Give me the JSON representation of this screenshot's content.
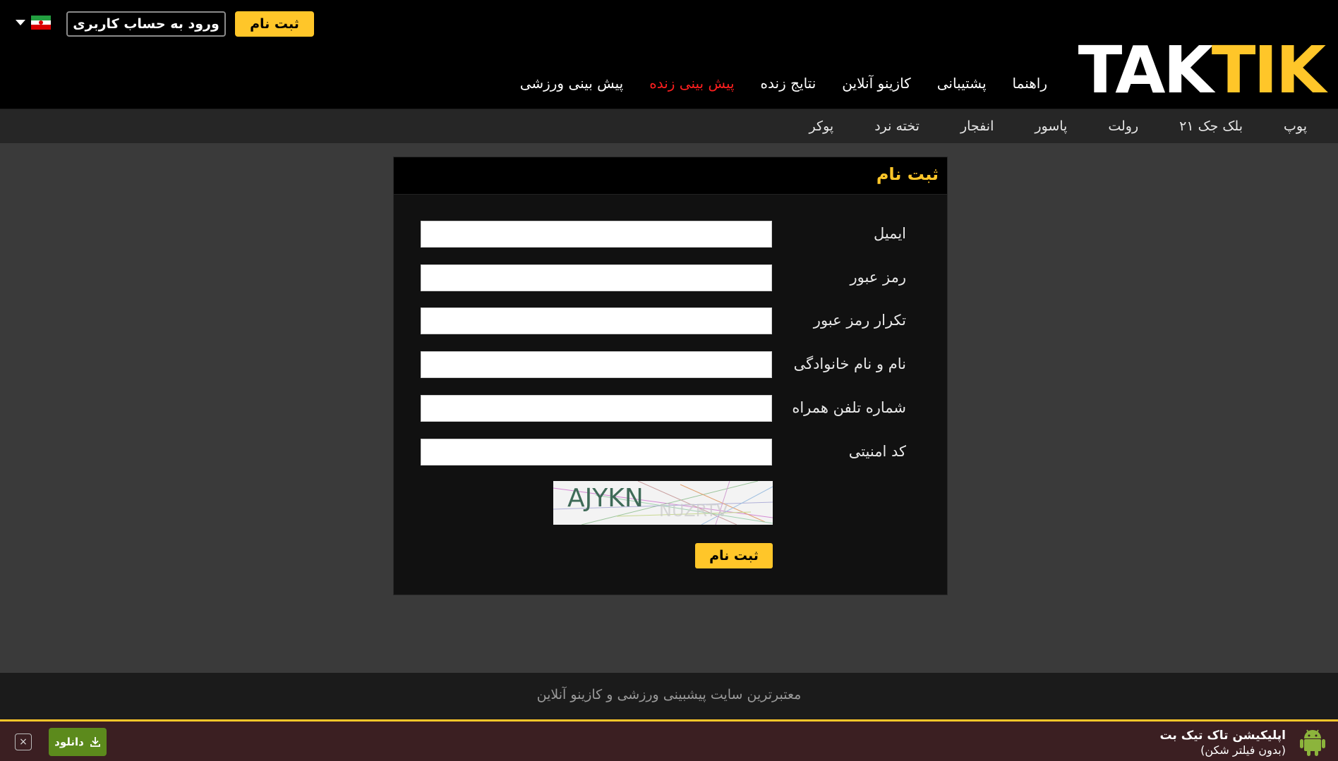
{
  "header": {
    "logo_left": "TAK",
    "logo_right": "TIK",
    "login_label": "ورود به حساب کاربری",
    "register_label": "ثبت نام",
    "nav": [
      {
        "label": "پیش بینی ورزشی"
      },
      {
        "label": "پیش بینی زنده",
        "active": true
      },
      {
        "label": "نتایج زنده"
      },
      {
        "label": "کازینو آنلاین"
      },
      {
        "label": "پشتیبانی"
      },
      {
        "label": "راهنما"
      }
    ]
  },
  "sub_nav": [
    {
      "label": "پوکر"
    },
    {
      "label": "تخته نرد"
    },
    {
      "label": "انفجار"
    },
    {
      "label": "پاسور"
    },
    {
      "label": "رولت"
    },
    {
      "label": "بلک جک ۲۱"
    },
    {
      "label": "پوپ"
    }
  ],
  "form": {
    "title": "ثبت نام",
    "fields": [
      {
        "label": "ایمیل",
        "value": "",
        "placeholder": ""
      },
      {
        "label": "رمز عبور",
        "value": "",
        "placeholder": ""
      },
      {
        "label": "تکرار رمز عبور",
        "value": "",
        "placeholder": ""
      },
      {
        "label": "نام و نام خانوادگی",
        "value": "",
        "placeholder": ""
      },
      {
        "label": "شماره تلفن همراه",
        "value": "",
        "placeholder": ""
      },
      {
        "label": "کد امنیتی",
        "value": "",
        "placeholder": ""
      }
    ],
    "captcha_text": "AJYKN",
    "submit_label": "ثبت نام"
  },
  "footer": {
    "text": "معتبرترین سایت پیشبینی ورزشی و کازینو آنلاین"
  },
  "app_banner": {
    "title": "اپلیکیشن تاک تیک بت",
    "subtitle": "(بدون فیلتر شکن)",
    "download_label": "دانلود",
    "close_glyph": "×"
  },
  "colors": {
    "accent": "#ffc629",
    "active_nav": "#ff1f1f",
    "download": "#5c8a1c",
    "banner_bg": "#3b1f22"
  }
}
